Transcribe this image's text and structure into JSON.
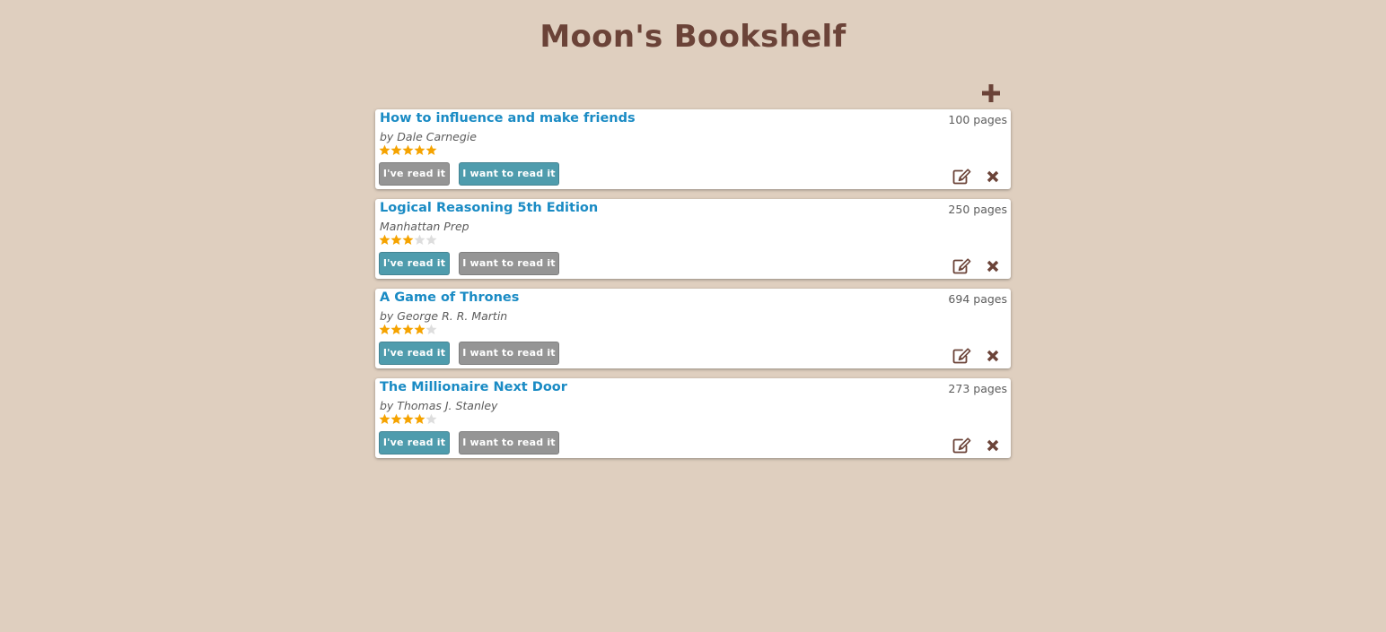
{
  "header": {
    "title": "Moon's Bookshelf"
  },
  "toolbar": {
    "add_icon": "plus-icon"
  },
  "colors": {
    "background": "#dfcfbf",
    "title": "#6b4338",
    "book_title": "#1a8bc4",
    "button_active": "#4f9cad",
    "button_inactive": "#959595",
    "star_filled": "#f5a300",
    "star_empty": "#dddddd"
  },
  "books": [
    {
      "title": "How to influence and make friends",
      "author": "by Dale Carnegie",
      "pages": "100 pages",
      "rating": 5,
      "max_rating": 5,
      "read_label": "I've read it",
      "want_label": "I want to read it",
      "status": "want"
    },
    {
      "title": "Logical Reasoning 5th Edition",
      "author": "Manhattan Prep",
      "pages": "250 pages",
      "rating": 3,
      "max_rating": 5,
      "read_label": "I've read it",
      "want_label": "I want to read it",
      "status": "read"
    },
    {
      "title": "A Game of Thrones",
      "author": "by George R. R. Martin",
      "pages": "694 pages",
      "rating": 4,
      "max_rating": 5,
      "read_label": "I've read it",
      "want_label": "I want to read it",
      "status": "read"
    },
    {
      "title": "The Millionaire Next Door",
      "author": "by Thomas J. Stanley",
      "pages": "273 pages",
      "rating": 4,
      "max_rating": 5,
      "read_label": "I've read it",
      "want_label": "I want to read it",
      "status": "read"
    }
  ]
}
